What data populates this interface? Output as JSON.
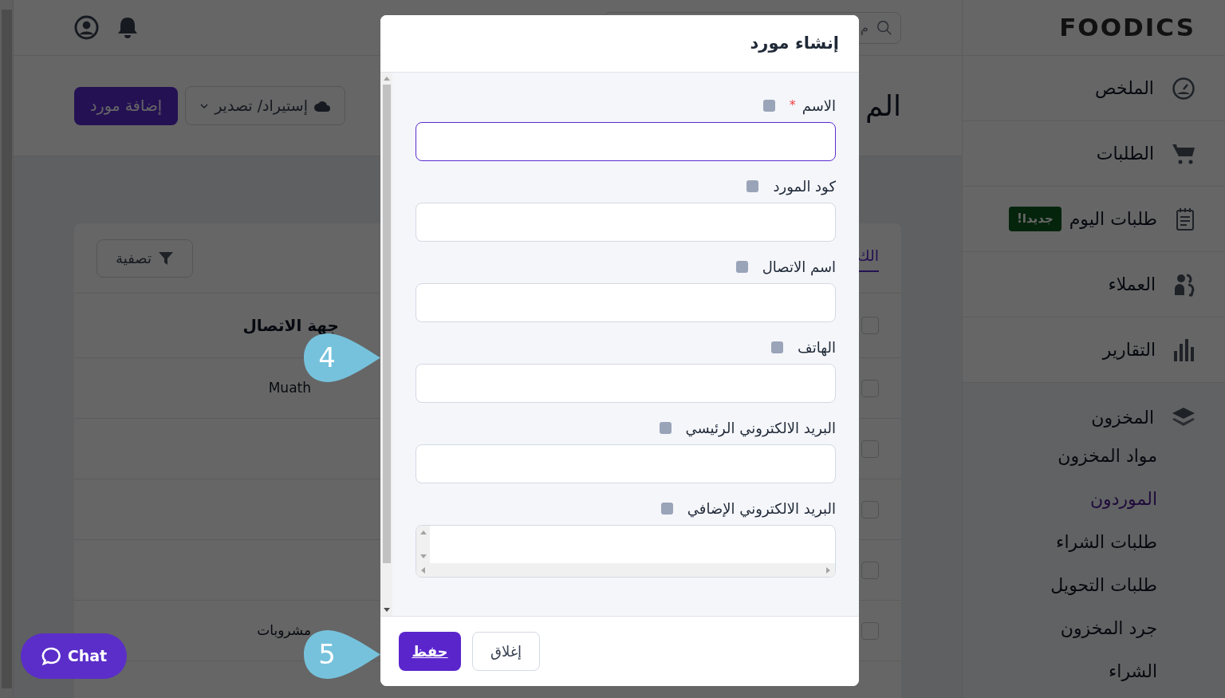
{
  "sidebar": {
    "logo": "FOODICS",
    "items": [
      {
        "label": "الملخص",
        "kind": "gauge"
      },
      {
        "label": "الطلبات",
        "kind": "cart"
      },
      {
        "label": "طلبات اليوم",
        "kind": "clipboard",
        "badge": "جديدا!"
      },
      {
        "label": "العملاء",
        "kind": "users"
      },
      {
        "label": "التقارير",
        "kind": "chart"
      },
      {
        "label": "المخزون",
        "kind": "layers",
        "children": [
          {
            "label": "مواد المخزون",
            "selected": false
          },
          {
            "label": "الموردون",
            "selected": true
          },
          {
            "label": "طلبات الشراء",
            "selected": false
          },
          {
            "label": "طلبات التحويل",
            "selected": false
          },
          {
            "label": "جرد المخزون",
            "selected": false
          },
          {
            "label": "الشراء",
            "selected": false
          }
        ]
      }
    ]
  },
  "header": {
    "search": {
      "placeholder": "م"
    }
  },
  "page": {
    "title": "الم",
    "actions": [
      {
        "label": "إستيراد/ تصدير",
        "kind": "dropdown"
      },
      {
        "label": "إضافة مورد",
        "kind": "primary"
      }
    ]
  },
  "card": {
    "tabs": [
      {
        "label": "الك",
        "selected": true
      }
    ],
    "filter_button": "تصفية",
    "table": {
      "select_all": {
        "checked": false
      },
      "columns": [
        "جهة الاتصال"
      ],
      "rows": [
        {
          "checked": false,
          "contact": "Muath"
        },
        {
          "checked": false
        },
        {
          "checked": false
        },
        {
          "checked": false
        },
        {
          "checked": false,
          "contact": "مشروبات"
        }
      ]
    }
  },
  "modal": {
    "title": "إنشاء مورد",
    "fields": [
      {
        "label": "الاسم",
        "required_mark": "*",
        "kind": "input",
        "focused": true
      },
      {
        "label": "كود المورد",
        "kind": "input",
        "focused": false
      },
      {
        "label": "اسم الاتصال",
        "kind": "input",
        "focused": false
      },
      {
        "label": "الهاتف",
        "kind": "input",
        "focused": false
      },
      {
        "label": "البريد الالكتروني الرئيسي",
        "kind": "input",
        "focused": false
      },
      {
        "label": "البريد الالكتروني الإضافي",
        "kind": "textarea",
        "focused": false
      }
    ],
    "buttons": [
      {
        "label": "إغلاق",
        "kind": "secondary"
      },
      {
        "label": "حفظ",
        "kind": "primary"
      }
    ]
  },
  "callouts": [
    "4",
    "5"
  ],
  "chat": {
    "label": "Chat"
  }
}
